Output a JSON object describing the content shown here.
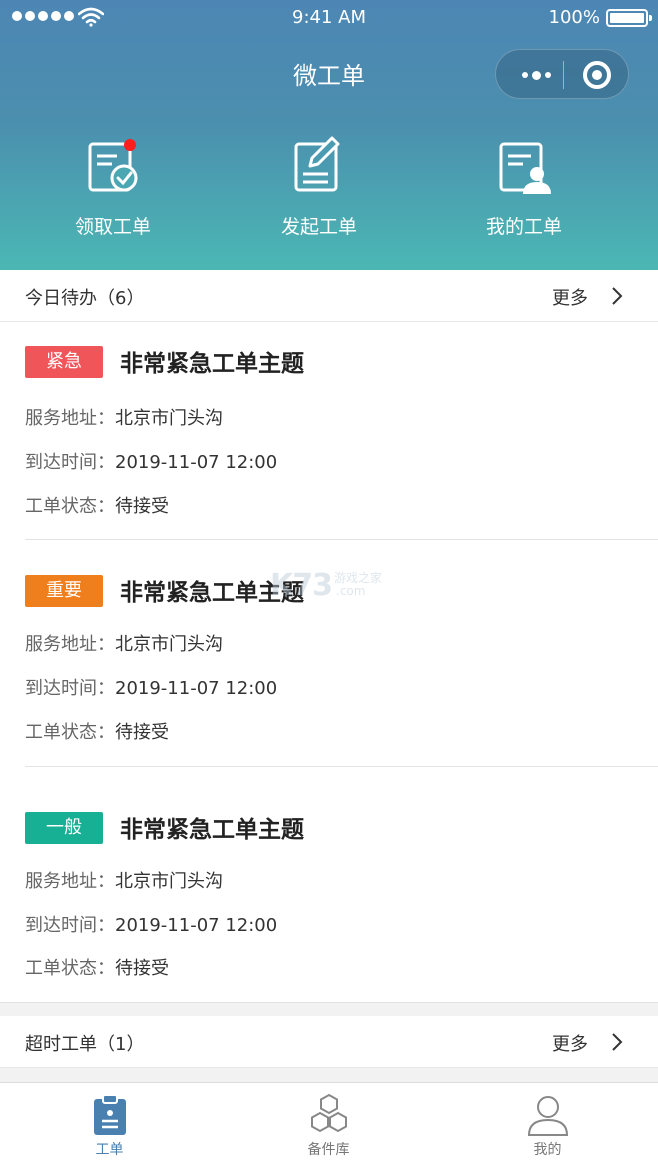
{
  "status_bar": {
    "time": "9:41 AM",
    "battery": "100%"
  },
  "nav": {
    "title": "微工单"
  },
  "quick_actions": [
    {
      "label": "领取工单",
      "icon": "receive-order-icon"
    },
    {
      "label": "发起工单",
      "icon": "edit-order-icon"
    },
    {
      "label": "我的工单",
      "icon": "my-order-icon"
    }
  ],
  "today": {
    "title": "今日待办（6）",
    "more": "更多",
    "orders": [
      {
        "badge": "紧急",
        "badge_color": "#f0555a",
        "title": "非常紧急工单主题",
        "address_label": "服务地址：",
        "address": "北京市门头沟",
        "time_label": "到达时间：",
        "time": "2019-11-07 12:00",
        "status_label": "工单状态：",
        "status": "待接受"
      },
      {
        "badge": "重要",
        "badge_color": "#ef7e1d",
        "title": "非常紧急工单主题",
        "address_label": "服务地址：",
        "address": "北京市门头沟",
        "time_label": "到达时间：",
        "time": "2019-11-07 12:00",
        "status_label": "工单状态：",
        "status": "待接受"
      },
      {
        "badge": "一般",
        "badge_color": "#17b094",
        "title": "非常紧急工单主题",
        "address_label": "服务地址：",
        "address": "北京市门头沟",
        "time_label": "到达时间：",
        "time": "2019-11-07 12:00",
        "status_label": "工单状态：",
        "status": "待接受"
      }
    ]
  },
  "overdue": {
    "title": "超时工单（1）",
    "more": "更多"
  },
  "tabbar": [
    {
      "label": "工单",
      "icon": "clipboard-icon",
      "active": true
    },
    {
      "label": "备件库",
      "icon": "hexagons-icon",
      "active": false
    },
    {
      "label": "我的",
      "icon": "user-icon",
      "active": false
    }
  ],
  "watermark": {
    "brand": "K73",
    "cn": "游戏之家",
    "domain": ".com"
  },
  "colors": {
    "accent": "#4a80b0",
    "header_top": "#4d86b4",
    "header_bottom": "#4bb7b4",
    "badge_red": "#f0555a",
    "badge_orange": "#ef7e1d",
    "badge_green": "#17b094"
  }
}
